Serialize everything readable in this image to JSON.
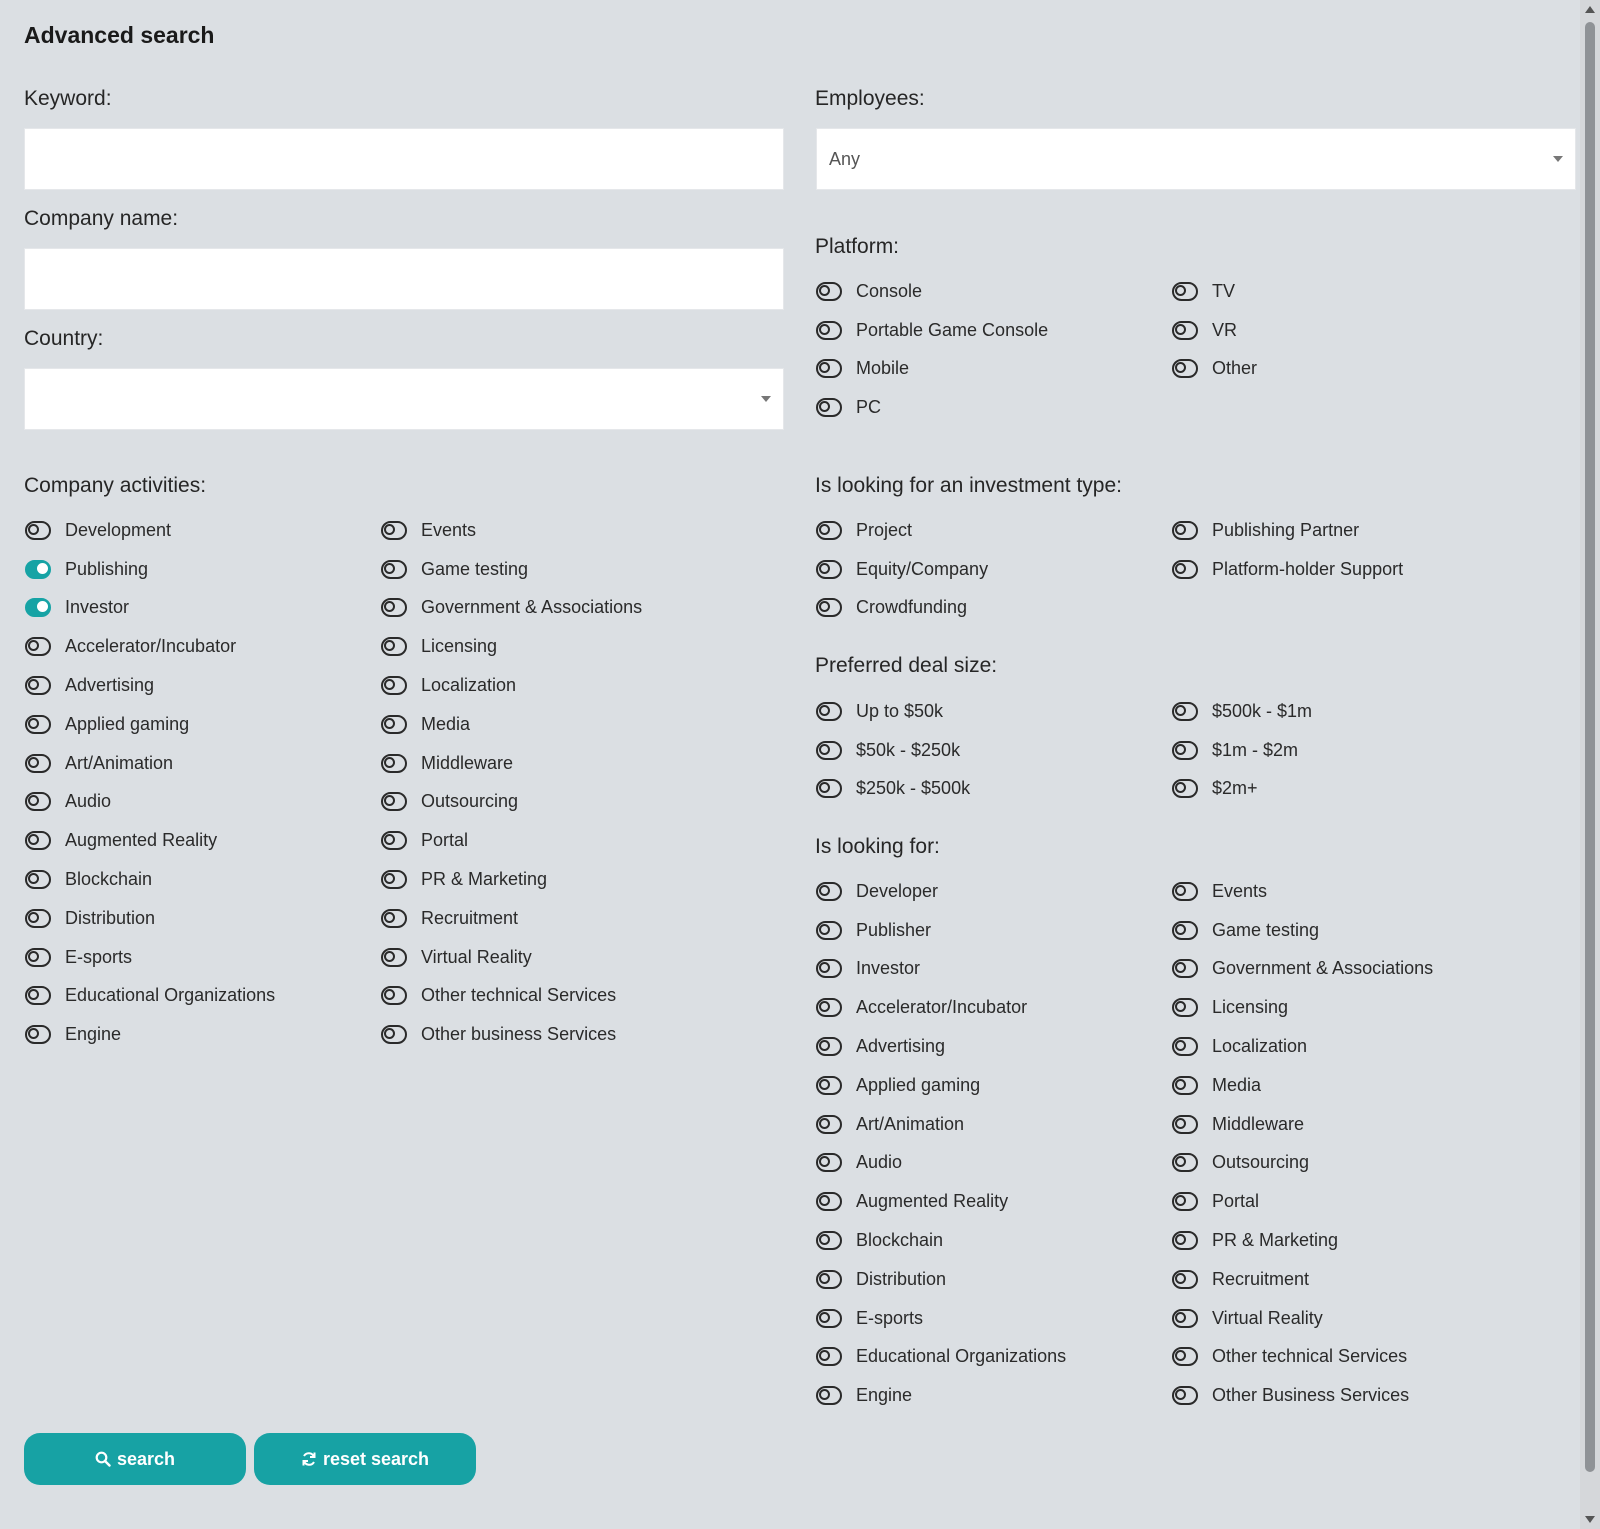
{
  "page": {
    "title": "Advanced search"
  },
  "form": {
    "keyword": {
      "label": "Keyword:",
      "value": "",
      "placeholder": ""
    },
    "company_name": {
      "label": "Company name:",
      "value": "",
      "placeholder": ""
    },
    "country": {
      "label": "Country:",
      "selected": ""
    },
    "employees": {
      "label": "Employees:",
      "selected": "Any"
    }
  },
  "groups": {
    "company_activities": {
      "label": "Company activities:",
      "items": [
        {
          "label": "Development",
          "on": false
        },
        {
          "label": "Events",
          "on": false
        },
        {
          "label": "Publishing",
          "on": true
        },
        {
          "label": "Game testing",
          "on": false
        },
        {
          "label": "Investor",
          "on": true
        },
        {
          "label": "Government & Associations",
          "on": false
        },
        {
          "label": "Accelerator/Incubator",
          "on": false
        },
        {
          "label": "Licensing",
          "on": false
        },
        {
          "label": "Advertising",
          "on": false
        },
        {
          "label": "Localization",
          "on": false
        },
        {
          "label": "Applied gaming",
          "on": false
        },
        {
          "label": "Media",
          "on": false
        },
        {
          "label": "Art/Animation",
          "on": false
        },
        {
          "label": "Middleware",
          "on": false
        },
        {
          "label": "Audio",
          "on": false
        },
        {
          "label": "Outsourcing",
          "on": false
        },
        {
          "label": "Augmented Reality",
          "on": false
        },
        {
          "label": "Portal",
          "on": false
        },
        {
          "label": "Blockchain",
          "on": false
        },
        {
          "label": "PR & Marketing",
          "on": false
        },
        {
          "label": "Distribution",
          "on": false
        },
        {
          "label": "Recruitment",
          "on": false
        },
        {
          "label": "E-sports",
          "on": false
        },
        {
          "label": "Virtual Reality",
          "on": false
        },
        {
          "label": "Educational Organizations",
          "on": false
        },
        {
          "label": "Other technical Services",
          "on": false
        },
        {
          "label": "Engine",
          "on": false
        },
        {
          "label": "Other business Services",
          "on": false
        }
      ]
    },
    "platform": {
      "label": "Platform:",
      "items": [
        {
          "label": "Console",
          "on": false
        },
        {
          "label": "TV",
          "on": false
        },
        {
          "label": "Portable Game Console",
          "on": false
        },
        {
          "label": "VR",
          "on": false
        },
        {
          "label": "Mobile",
          "on": false
        },
        {
          "label": "Other",
          "on": false
        },
        {
          "label": "PC",
          "on": false
        }
      ]
    },
    "investment_type": {
      "label": "Is looking for an investment type:",
      "items": [
        {
          "label": "Project",
          "on": false
        },
        {
          "label": "Publishing Partner",
          "on": false
        },
        {
          "label": "Equity/Company",
          "on": false
        },
        {
          "label": "Platform-holder Support",
          "on": false
        },
        {
          "label": "Crowdfunding",
          "on": false
        }
      ]
    },
    "deal_size": {
      "label": "Preferred deal size:",
      "items": [
        {
          "label": "Up to $50k",
          "on": false
        },
        {
          "label": "$500k - $1m",
          "on": false
        },
        {
          "label": "$50k - $250k",
          "on": false
        },
        {
          "label": "$1m - $2m",
          "on": false
        },
        {
          "label": "$250k - $500k",
          "on": false
        },
        {
          "label": "$2m+",
          "on": false
        }
      ]
    },
    "looking_for": {
      "label": "Is looking for:",
      "items": [
        {
          "label": "Developer",
          "on": false
        },
        {
          "label": "Events",
          "on": false
        },
        {
          "label": "Publisher",
          "on": false
        },
        {
          "label": "Game testing",
          "on": false
        },
        {
          "label": "Investor",
          "on": false
        },
        {
          "label": "Government & Associations",
          "on": false
        },
        {
          "label": "Accelerator/Incubator",
          "on": false
        },
        {
          "label": "Licensing",
          "on": false
        },
        {
          "label": "Advertising",
          "on": false
        },
        {
          "label": "Localization",
          "on": false
        },
        {
          "label": "Applied gaming",
          "on": false
        },
        {
          "label": "Media",
          "on": false
        },
        {
          "label": "Art/Animation",
          "on": false
        },
        {
          "label": "Middleware",
          "on": false
        },
        {
          "label": "Audio",
          "on": false
        },
        {
          "label": "Outsourcing",
          "on": false
        },
        {
          "label": "Augmented Reality",
          "on": false
        },
        {
          "label": "Portal",
          "on": false
        },
        {
          "label": "Blockchain",
          "on": false
        },
        {
          "label": "PR & Marketing",
          "on": false
        },
        {
          "label": "Distribution",
          "on": false
        },
        {
          "label": "Recruitment",
          "on": false
        },
        {
          "label": "E-sports",
          "on": false
        },
        {
          "label": "Virtual Reality",
          "on": false
        },
        {
          "label": "Educational Organizations",
          "on": false
        },
        {
          "label": "Other technical Services",
          "on": false
        },
        {
          "label": "Engine",
          "on": false
        },
        {
          "label": "Other Business Services",
          "on": false
        }
      ]
    }
  },
  "buttons": {
    "search": {
      "label": "search",
      "icon": "search-icon"
    },
    "reset": {
      "label": "reset search",
      "icon": "refresh-icon"
    }
  },
  "colors": {
    "accent": "#17a2a4",
    "background": "#dbdfe3"
  }
}
